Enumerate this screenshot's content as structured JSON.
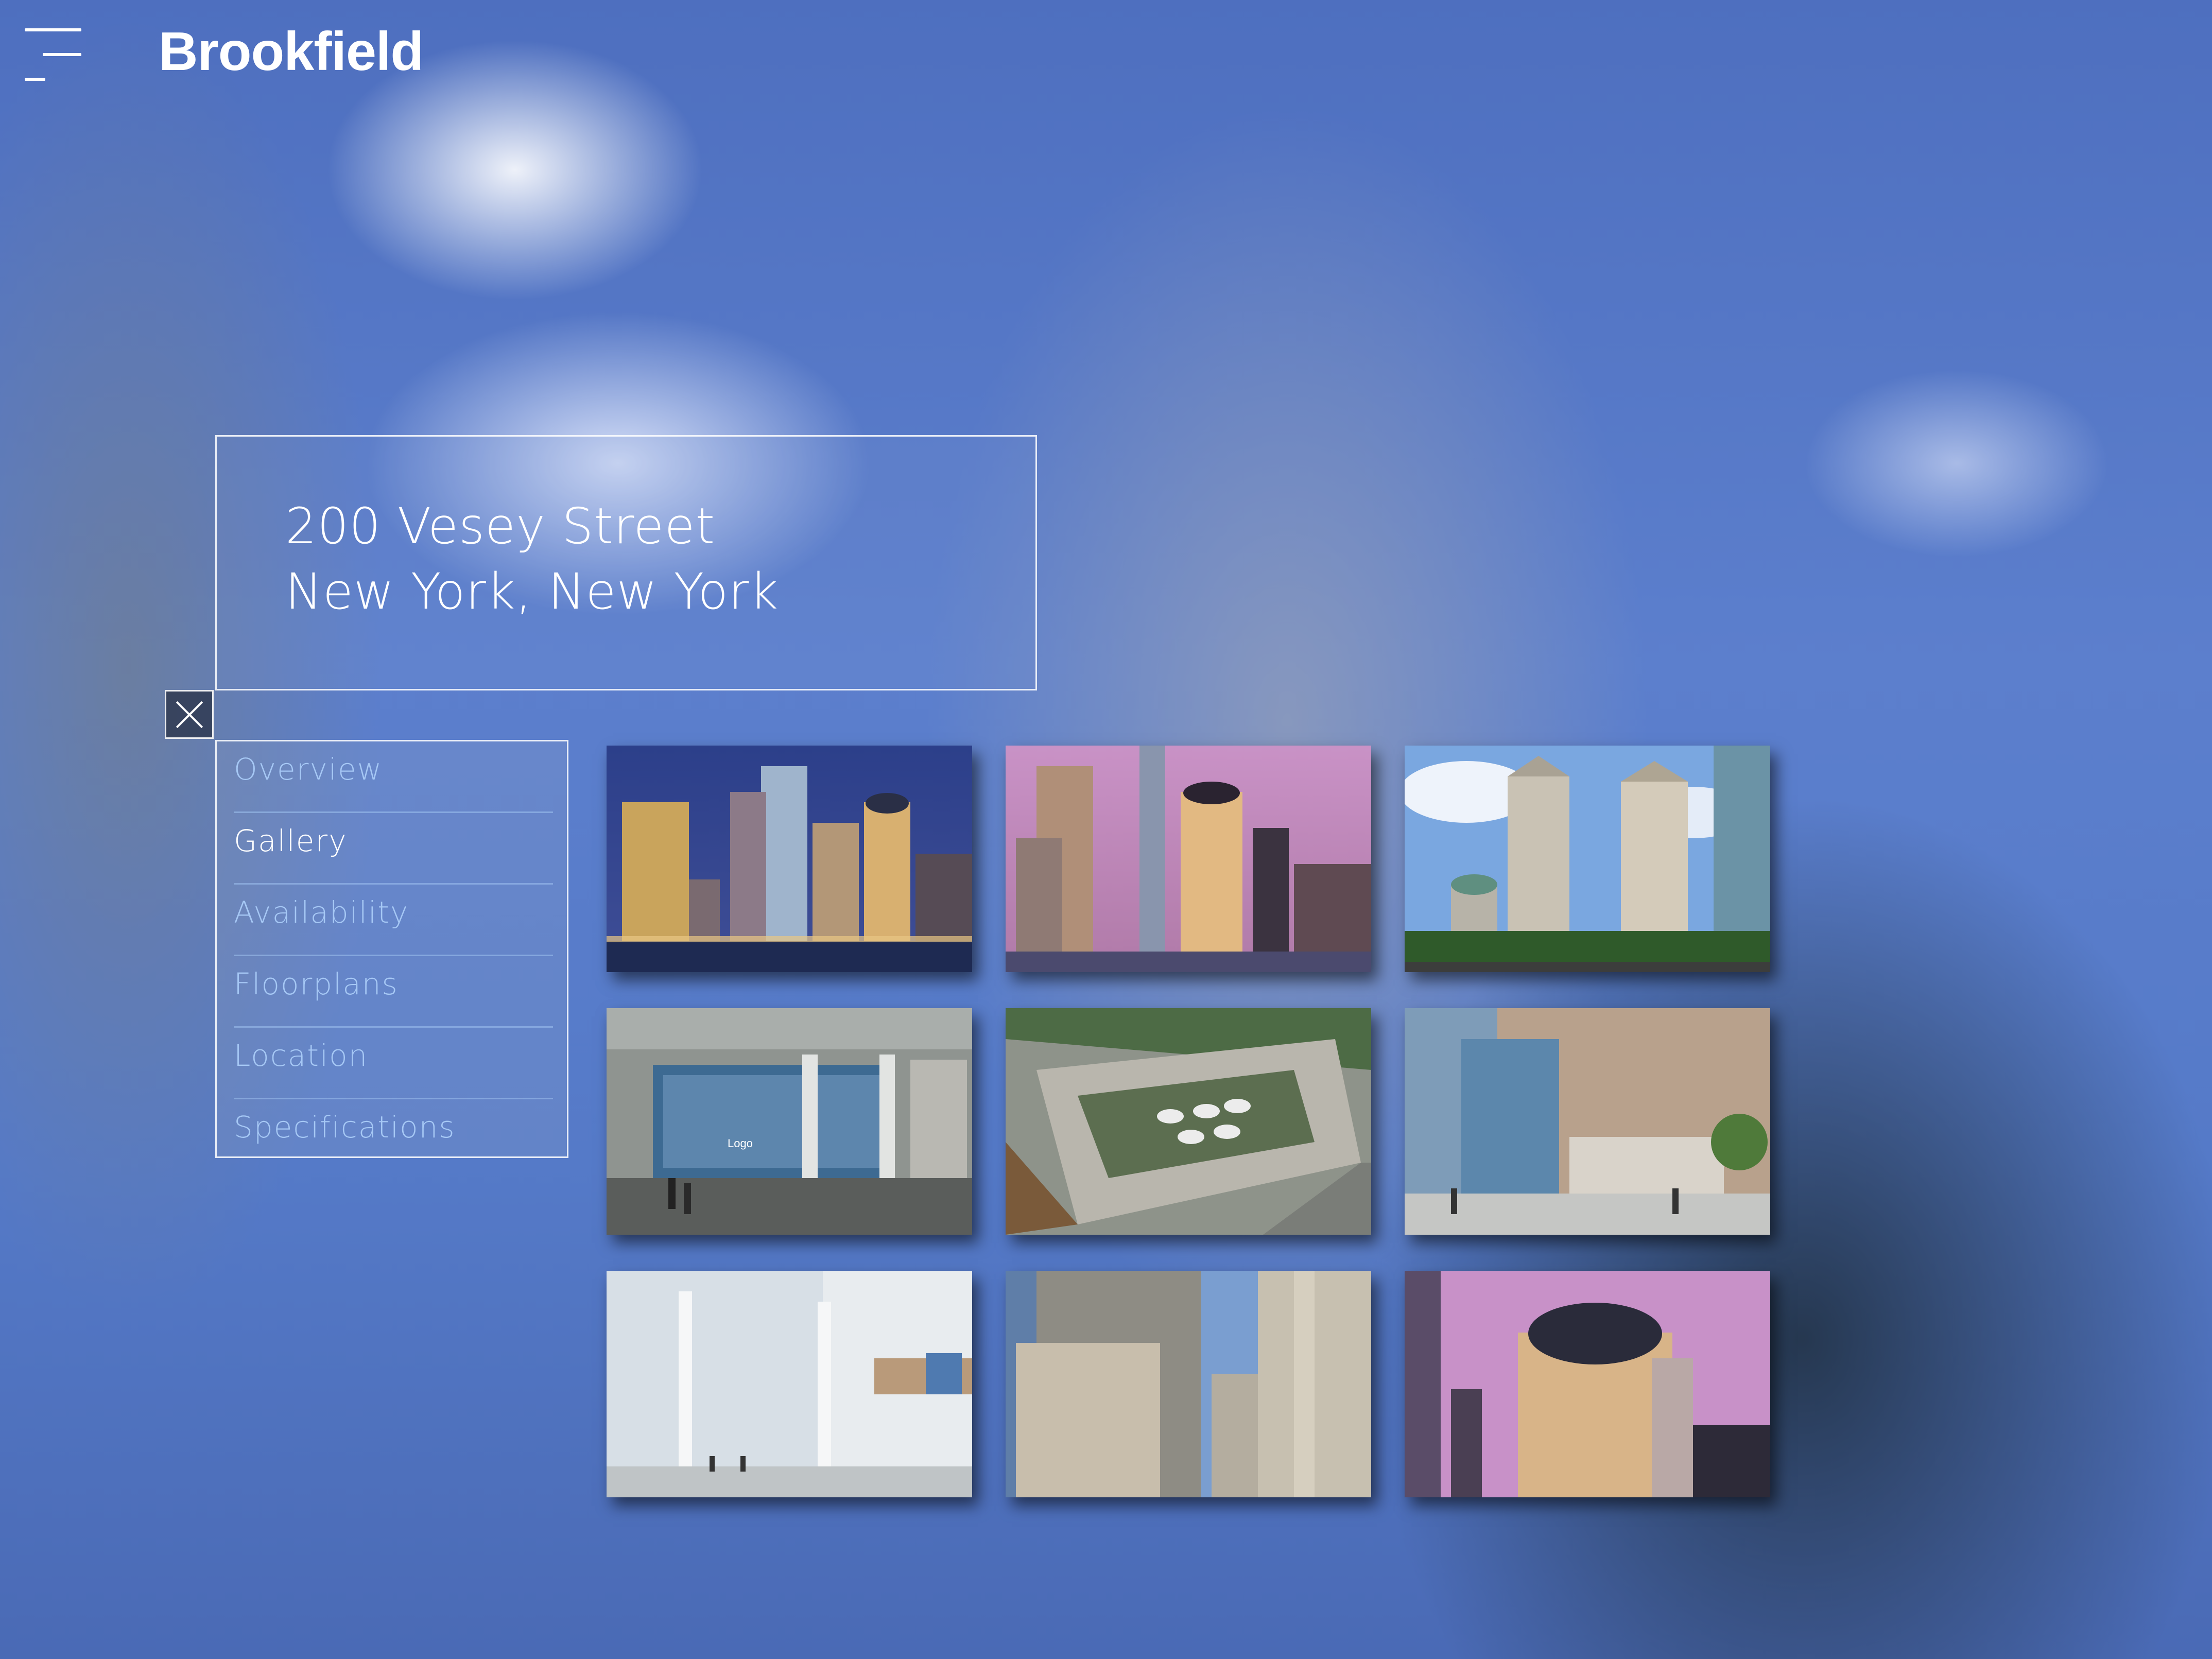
{
  "header": {
    "menu_icon": "hamburger-menu-icon",
    "brand": "Brookfield"
  },
  "property": {
    "address_line1": "200 Vesey Street",
    "address_line2": "New York, New York"
  },
  "close_icon": "close-x-icon",
  "nav": {
    "active": "Gallery",
    "items": [
      {
        "label": "Overview"
      },
      {
        "label": "Gallery"
      },
      {
        "label": "Availability"
      },
      {
        "label": "Floorplans"
      },
      {
        "label": "Location"
      },
      {
        "label": "Specifications"
      }
    ]
  },
  "gallery": {
    "thumbnails": [
      {
        "subject": "skyline-dusk-waterfront"
      },
      {
        "subject": "skyline-pink-sky"
      },
      {
        "subject": "towers-daytime-blue-sky"
      },
      {
        "subject": "lobby-rendering-logo-wall",
        "text": "Logo"
      },
      {
        "subject": "rooftop-terrace-aerial"
      },
      {
        "subject": "plaza-glass-entrance"
      },
      {
        "subject": "bright-white-atrium"
      },
      {
        "subject": "tower-facades-closeup"
      },
      {
        "subject": "domed-tower-pink-sky"
      }
    ]
  },
  "colors": {
    "nav_inactive": "#a6c8f5",
    "nav_active": "#ffffff",
    "sky": "#5c7fcd"
  }
}
